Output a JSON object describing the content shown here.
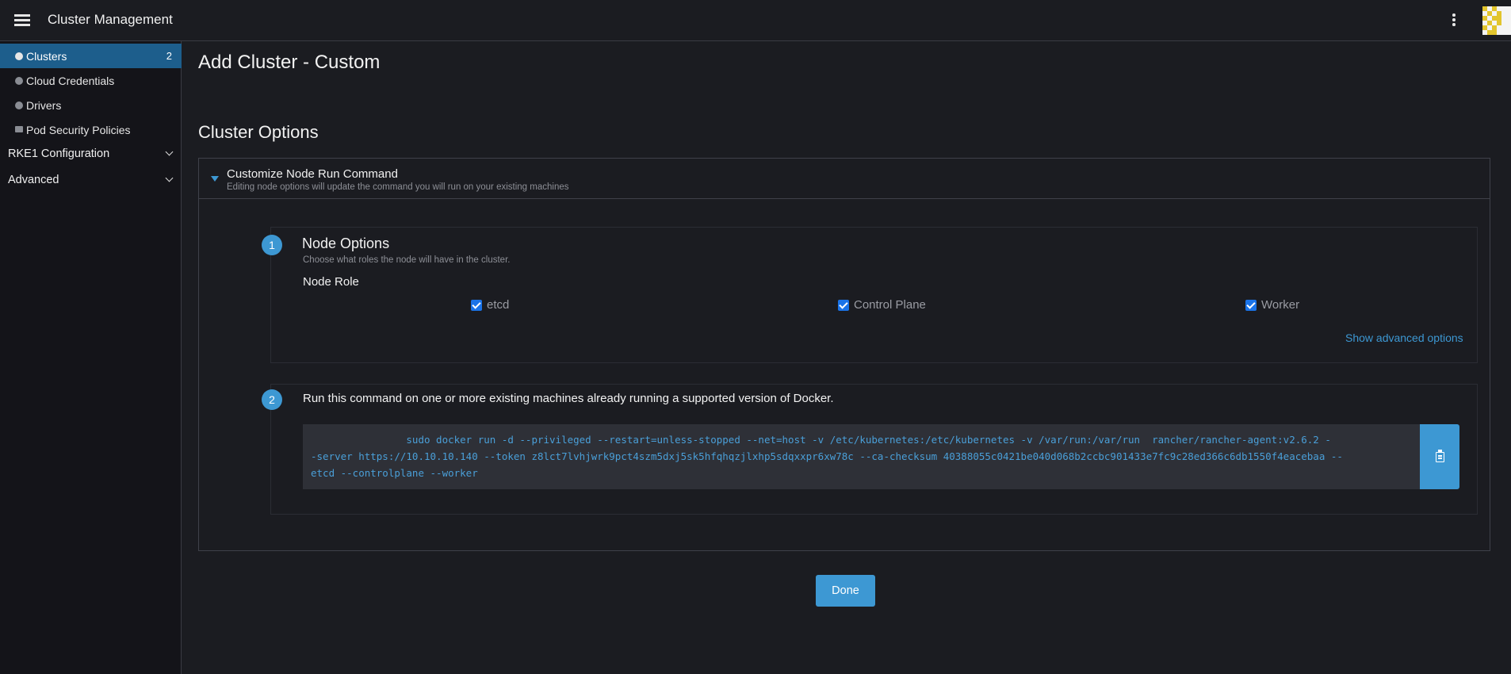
{
  "header": {
    "title": "Cluster Management",
    "menu_icon": "hamburger-menu-icon",
    "more_icon": "kebab-menu-icon"
  },
  "sidebar": {
    "items": [
      {
        "label": "Clusters",
        "count": "2",
        "icon": "globe-icon",
        "active": true
      },
      {
        "label": "Cloud Credentials",
        "icon": "globe-icon"
      },
      {
        "label": "Drivers",
        "icon": "globe-icon"
      },
      {
        "label": "Pod Security Policies",
        "icon": "folder-icon"
      }
    ],
    "groups": [
      {
        "label": "RKE1 Configuration"
      },
      {
        "label": "Advanced"
      }
    ]
  },
  "main": {
    "title": "Add Cluster - Custom",
    "section_title": "Cluster Options",
    "accordion": {
      "title": "Customize Node Run Command",
      "subtitle": "Editing node options will update the command you will run on your existing machines"
    },
    "step1": {
      "number": "1",
      "title": "Node Options",
      "subtitle": "Choose what roles the node will have in the cluster.",
      "role_label": "Node Role",
      "roles": [
        {
          "label": "etcd",
          "checked": true
        },
        {
          "label": "Control Plane",
          "checked": true
        },
        {
          "label": "Worker",
          "checked": true
        }
      ],
      "advanced_link": "Show advanced options"
    },
    "step2": {
      "number": "2",
      "text": "Run this command on one or more existing machines already running a supported version of Docker.",
      "command_lines": [
        "                sudo docker run -d --privileged --restart=unless-stopped --net=host -v /etc/kubernetes:/etc/kubernetes -v /var/run:/var/run  rancher/rancher-agent:v2.6.2 -",
        "-server https://10.10.10.140 --token z8lct7lvhjwrk9pct4szm5dxj5sk5hfqhqzjlxhp5sdqxxpr6xw78c --ca-checksum 40388055c0421be040d068b2ccbc901433e7fc9c28ed366c6db1550f4eacebaa --",
        "etcd --controlplane --worker"
      ],
      "copy_icon": "clipboard-icon"
    },
    "done_label": "Done"
  },
  "colors": {
    "accent": "#3d98d3",
    "active_nav": "#1d5e8c",
    "background": "#1b1c21",
    "sidebar": "#141419"
  }
}
